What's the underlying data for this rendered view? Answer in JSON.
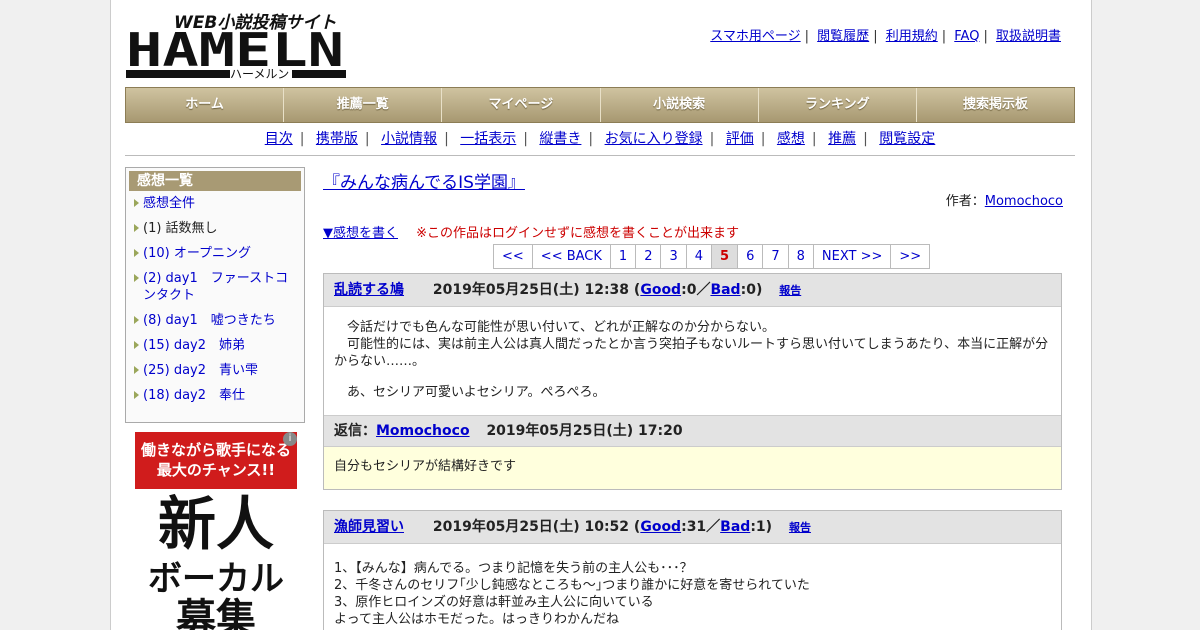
{
  "site": {
    "logo_small": "WEB小説投稿サイト",
    "logo_main": "HAMELN",
    "logo_kana": "ハーメルン"
  },
  "top_links": [
    "スマホ用ページ",
    "閲覧履歴",
    "利用規約",
    "FAQ",
    "取扱説明書"
  ],
  "main_nav": [
    "ホーム",
    "推薦一覧",
    "マイページ",
    "小説検索",
    "ランキング",
    "捜索掲示板"
  ],
  "sub_nav": [
    "目次",
    "携帯版",
    "小説情報",
    "一括表示",
    "縦書き",
    "お気に入り登録",
    "評価",
    "感想",
    "推薦",
    "閲覧設定"
  ],
  "sidebar": {
    "title": "感想一覧",
    "items": [
      {
        "label": "感想全件",
        "link": true
      },
      {
        "label": "(1) 話数無し",
        "link": false
      },
      {
        "label": "(10) オープニング",
        "link": true
      },
      {
        "label": "(2) day1　ファーストコンタクト",
        "link": true
      },
      {
        "label": "(8) day1　嘘つきたち",
        "link": true
      },
      {
        "label": "(15) day2　姉弟",
        "link": true
      },
      {
        "label": "(25) day2　青い雫",
        "link": true
      },
      {
        "label": "(18) day2　奉仕",
        "link": true
      }
    ]
  },
  "ad": {
    "line1": "働きながら歌手になる",
    "line2": "最大のチャンス!!",
    "big1": "新人",
    "big2": "ボーカル",
    "big3": "募集",
    "info_icon": "info-icon"
  },
  "novel": {
    "title": "『みんな病んでるIS学園』",
    "author_label": "作者：",
    "author": "Momochoco"
  },
  "write": {
    "link": "▼感想を書く",
    "warning": "※この作品はログインせずに感想を書くことが出来ます"
  },
  "pager": [
    "<<",
    "<< BACK",
    "1",
    "2",
    "3",
    "4",
    "5",
    "6",
    "7",
    "8",
    "NEXT >>",
    ">>"
  ],
  "pager_current": "5",
  "comments": [
    {
      "user": "乱読する鳩",
      "date": "2019年05月25日(土) 12:38",
      "good_label": "Good",
      "good": "0",
      "bad_label": "Bad",
      "bad": "0",
      "report": "報告",
      "body": [
        "　今話だけでも色んな可能性が思い付いて、どれが正解なのか分からない。",
        "　可能性的には、実は前主人公は真人間だったとか言う突拍子もないルートすら思い付いてしまうあたり、本当に正解が分からない……。",
        "　あ、セシリア可愛いよセシリア。ぺろぺろ。"
      ],
      "reply_label": "返信：",
      "reply_user": "Momochoco",
      "reply_date": "2019年05月25日(土) 17:20",
      "reply_text": "自分もセシリアが結構好きです"
    },
    {
      "user": "漁師見習い",
      "date": "2019年05月25日(土) 10:52",
      "good_label": "Good",
      "good": "31",
      "bad_label": "Bad",
      "bad": "1",
      "report": "報告",
      "body": [
        "1、【みんな】病んでる。つまり記憶を失う前の主人公も･･･？",
        "2、千冬さんのセリフ｢少し鈍感なところも〜｣つまり誰かに好意を寄せられていた",
        "3、原作ヒロインズの好意は軒並み主人公に向いている",
        "よって主人公はホモだった。はっきりわかんだね"
      ]
    }
  ]
}
